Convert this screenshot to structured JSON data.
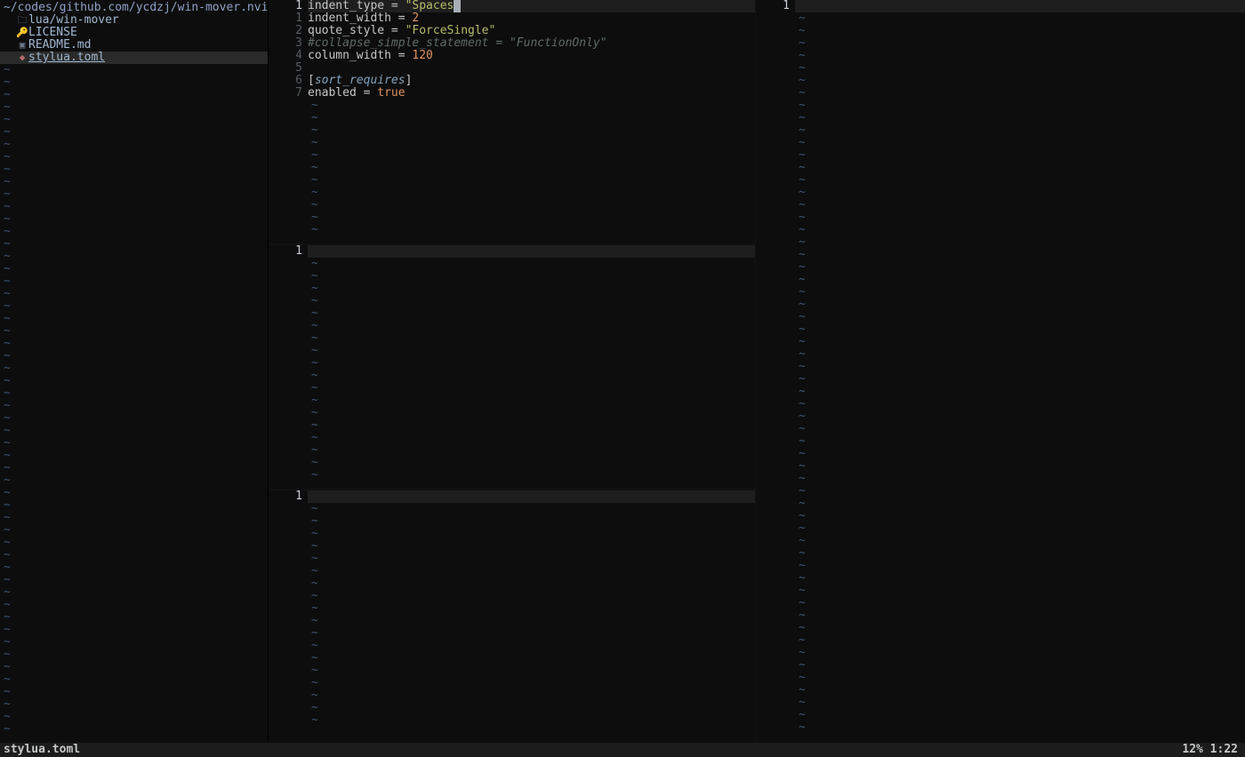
{
  "filetree": {
    "header": "~/codes/github.com/ycdzj/win-mover.nvi",
    "items": [
      {
        "icon": "folder",
        "label": "lua/win-mover",
        "selected": false
      },
      {
        "icon": "license",
        "label": "LICENSE",
        "selected": false
      },
      {
        "icon": "md",
        "label": "README.md",
        "selected": false
      },
      {
        "icon": "toml",
        "label": "stylua.toml",
        "selected": true
      }
    ]
  },
  "editor": {
    "current_line_number": "1",
    "lines": [
      {
        "n": "1",
        "current": true,
        "tokens": [
          {
            "cls": "tk-key",
            "t": "indent_type "
          },
          {
            "cls": "tk-op",
            "t": "= "
          },
          {
            "cls": "tk-str",
            "t": "\"Spaces"
          },
          {
            "cursor": true
          },
          {
            "cls": "tk-str",
            "t": ""
          }
        ]
      },
      {
        "n": "1",
        "tokens": [
          {
            "cls": "tk-key",
            "t": "indent_width "
          },
          {
            "cls": "tk-op",
            "t": "= "
          },
          {
            "cls": "tk-num",
            "t": "2"
          }
        ]
      },
      {
        "n": "2",
        "tokens": [
          {
            "cls": "tk-key",
            "t": "quote_style "
          },
          {
            "cls": "tk-op",
            "t": "= "
          },
          {
            "cls": "tk-str",
            "t": "\"ForceSingle\""
          }
        ]
      },
      {
        "n": "3",
        "tokens": [
          {
            "cls": "tk-cmt",
            "t": "#collapse_simple_statement = \"FunctionOnly\""
          }
        ]
      },
      {
        "n": "4",
        "tokens": [
          {
            "cls": "tk-key",
            "t": "column_width "
          },
          {
            "cls": "tk-op",
            "t": "= "
          },
          {
            "cls": "tk-num",
            "t": "120"
          }
        ]
      },
      {
        "n": "5",
        "tokens": []
      },
      {
        "n": "6",
        "tokens": [
          {
            "cls": "tk-op",
            "t": "["
          },
          {
            "cls": "tk-sect",
            "t": "sort_requires"
          },
          {
            "cls": "tk-op",
            "t": "]"
          }
        ]
      },
      {
        "n": "7",
        "tokens": [
          {
            "cls": "tk-key",
            "t": "enabled "
          },
          {
            "cls": "tk-op",
            "t": "= "
          },
          {
            "cls": "tk-bool",
            "t": "true"
          }
        ]
      }
    ]
  },
  "empty_pane_line_number": "1",
  "statusbar": {
    "file": "stylua.toml",
    "position": "12% 1:22"
  },
  "tilde_char": "~",
  "icons": {
    "folder": "🗀",
    "license": "🔑",
    "md": "▣",
    "toml": "◆"
  }
}
